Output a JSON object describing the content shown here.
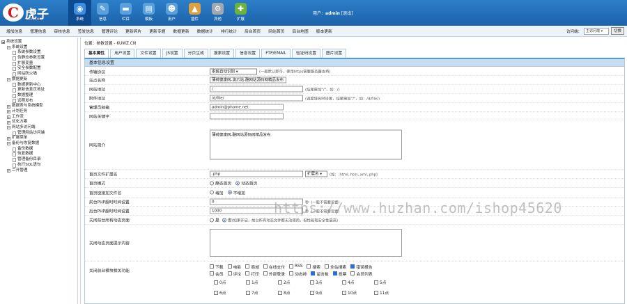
{
  "logo": {
    "mark": "C",
    "text": "虎子",
    "sub": "HUZI.CMS"
  },
  "topnav": [
    {
      "label": "系统",
      "icon": "globe-icon",
      "glyph": "◉",
      "color": "#3a8de0",
      "active": true
    },
    {
      "label": "信息",
      "icon": "edit-icon",
      "glyph": "✎",
      "color": "#5aa0dd"
    },
    {
      "label": "栏目",
      "icon": "folder-icon",
      "glyph": "▬",
      "color": "#5aa0dd"
    },
    {
      "label": "模板",
      "icon": "template-icon",
      "glyph": "▤",
      "color": "#5aa0dd"
    },
    {
      "label": "用户",
      "icon": "user-icon",
      "glyph": "☻",
      "color": "#5aa0dd"
    },
    {
      "label": "插件",
      "icon": "plugin-icon",
      "glyph": "▲",
      "color": "#e0a040"
    },
    {
      "label": "其他",
      "icon": "gear-icon",
      "glyph": "⚙",
      "color": "#a0a8b0"
    },
    {
      "label": "扩展",
      "icon": "plus-icon",
      "glyph": "✚",
      "color": "#6cb33e"
    }
  ],
  "userinfo": {
    "prefix": "用户：",
    "name": "admin",
    "logout": "[退出]"
  },
  "submenu": [
    "增加信息",
    "管理信息",
    "审核信息",
    "签发信息",
    "管理评论",
    "更新碎片",
    "更新专题",
    "数据更新",
    "数据统计",
    "排行统计",
    "后台首页",
    "网站首页",
    "后台地图",
    "版本更新"
  ],
  "access": {
    "label": "访问端：",
    "value": "主访问端",
    "button": "切换"
  },
  "sidebar": [
    {
      "label": "系统设置",
      "level": 0,
      "type": "root"
    },
    {
      "label": "系统设置",
      "level": 1,
      "type": "open"
    },
    {
      "label": "系统参数设置",
      "level": 2,
      "type": "file"
    },
    {
      "label": "伪静态参数设置",
      "level": 2,
      "type": "file"
    },
    {
      "label": "扩展变量",
      "level": 2,
      "type": "file"
    },
    {
      "label": "安全参数配置",
      "level": 2,
      "type": "file"
    },
    {
      "label": "网站防火墙",
      "level": 2,
      "type": "file"
    },
    {
      "label": "数据更新",
      "level": 1,
      "type": "open"
    },
    {
      "label": "数据更新中心",
      "level": 2,
      "type": "file"
    },
    {
      "label": "更新信息页地址",
      "level": 2,
      "type": "file"
    },
    {
      "label": "数据整理",
      "level": 2,
      "type": "file"
    },
    {
      "label": "远程发布",
      "level": 2,
      "type": "file"
    },
    {
      "label": "数据表与系统模型",
      "level": 1,
      "type": "closed"
    },
    {
      "label": "计划任务",
      "level": 1,
      "type": "closed"
    },
    {
      "label": "工作流",
      "level": 1,
      "type": "closed"
    },
    {
      "label": "优化方案",
      "level": 1,
      "type": "closed"
    },
    {
      "label": "网站多访问端",
      "level": 1,
      "type": "open"
    },
    {
      "label": "管理网站访问端",
      "level": 2,
      "type": "file"
    },
    {
      "label": "扩展菜单",
      "level": 1,
      "type": "closed"
    },
    {
      "label": "备份与恢复数据",
      "level": 1,
      "type": "open"
    },
    {
      "label": "备份数据",
      "level": 2,
      "type": "file"
    },
    {
      "label": "恢复数据",
      "level": 2,
      "type": "file"
    },
    {
      "label": "管理备份目录",
      "level": 2,
      "type": "file"
    },
    {
      "label": "执行SQL语句",
      "level": 2,
      "type": "file"
    },
    {
      "label": "二开管理",
      "level": 1,
      "type": "closed"
    }
  ],
  "crumb": "位置：参数设置 - KUWZ.CN",
  "tabs": [
    "基本属性",
    "用户设置",
    "文件设置",
    "JS设置",
    "分页生成",
    "搜索设置",
    "信息设置",
    "FTP/EMAIL",
    "验证码设置",
    "图片设置"
  ],
  "section": "基本信息设置",
  "form": {
    "protocol": {
      "label": "传输协议",
      "value": "系统自动识别",
      "hint": "(一般默认即可，使用https需要服务器支持)"
    },
    "sitename": {
      "label": "站点名称",
      "value": "薄荷健康网-演示站-酷网站源码网精品发布"
    },
    "siteurl": {
      "label": "网站地址",
      "value": "/",
      "hint": "(结尾需加\"/\"，如：/)"
    },
    "attachurl": {
      "label": "附件地址",
      "value": "/d/file/",
      "hint": "(调度域名时设置，结尾需加\"/\"，如：/d/file/)"
    },
    "email": {
      "label": "管理员邮箱",
      "value": "admin@phome.net"
    },
    "keywords": {
      "label": "网站关键字",
      "value": ""
    },
    "intro": {
      "label": "网站简介",
      "value": "薄荷健康网-酷网站源码网精品发布"
    },
    "ext": {
      "label": "首页文件扩展名",
      "value": ".php",
      "select": "扩展名",
      "hint": "(如：.html,.htm,.xml,.php)"
    },
    "indexmode": {
      "label": "首页模式",
      "options": [
        {
          "text": "静态首页",
          "on": false
        },
        {
          "text": "动态首页",
          "on": true
        }
      ]
    },
    "indexlink": {
      "label": "首页链接加文件名",
      "options": [
        {
          "text": "增加",
          "on": false
        },
        {
          "text": "不增加",
          "on": true
        }
      ]
    },
    "fronttimeout": {
      "label": "前台PHP超时时间设置",
      "value": "0",
      "unit": "秒",
      "hint": "(一般不需要设置)"
    },
    "backtimeout": {
      "label": "后台PHP超时时间设置",
      "value": "1000",
      "unit": "秒",
      "hint": "(一般不需要设置)"
    },
    "closefront": {
      "label": "关闭前台所有动态页面",
      "yes": "是",
      "no": "否",
      "hint": "(如果开启，前台所有动态文件都无法使用，但性能和安全性最高)"
    },
    "closetip": {
      "label": "关闭动态页面提示内容",
      "value": ""
    },
    "closefunc": {
      "label": "关闭前台模块相关功能",
      "row1": [
        {
          "text": "下载",
          "on": false
        },
        {
          "text": "电影",
          "on": false
        },
        {
          "text": "商城",
          "on": false
        },
        {
          "text": "在线支付",
          "on": false
        },
        {
          "text": "RSS",
          "on": false
        },
        {
          "text": "搜索",
          "on": false
        },
        {
          "text": "全站搜索",
          "on": false
        },
        {
          "text": "错误报告",
          "on": true
        }
      ],
      "row2": [
        {
          "text": "会员",
          "on": false
        },
        {
          "text": "评论",
          "on": false
        },
        {
          "text": "打印",
          "on": false
        },
        {
          "text": "外部登录",
          "on": false
        },
        {
          "text": "动态排",
          "on": false
        },
        {
          "text": "留言板",
          "on": true
        },
        {
          "text": "投票",
          "on": true
        },
        {
          "text": "会员列表",
          "on": false
        }
      ]
    },
    "hours1": [
      "0点",
      "1点",
      "2点",
      "3点",
      "4点",
      "5点"
    ],
    "hours2": [
      "6点",
      "7点",
      "8点",
      "9点",
      "10点",
      "11点"
    ]
  },
  "watermark": "https://www.huzhan.com/ishop45620"
}
